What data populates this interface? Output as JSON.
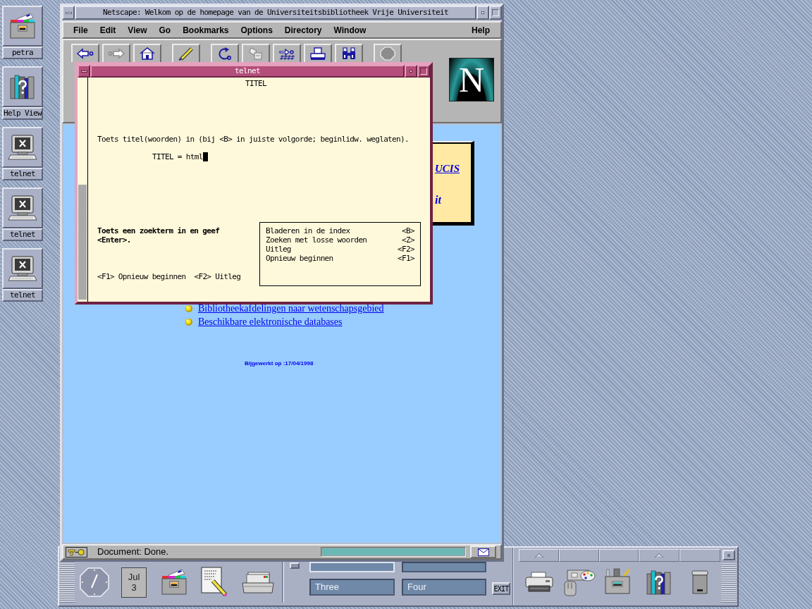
{
  "desktop_icons": [
    {
      "label": "petra",
      "kind": "folder"
    },
    {
      "label": "Help View",
      "kind": "help"
    },
    {
      "label": "telnet",
      "kind": "terminal"
    },
    {
      "label": "telnet",
      "kind": "terminal"
    },
    {
      "label": "telnet",
      "kind": "terminal"
    }
  ],
  "browser": {
    "title": "Netscape: Welkom op de homepage van de Universiteitsbibliotheek Vrije Universiteit",
    "menu": [
      "File",
      "Edit",
      "View",
      "Go",
      "Bookmarks",
      "Options",
      "Directory",
      "Window"
    ],
    "help_menu": "Help",
    "toolbar": [
      {
        "disabled": false
      },
      {
        "disabled": true
      },
      {
        "disabled": false
      },
      {
        "disabled": false
      },
      {
        "disabled": false
      },
      {
        "disabled": true
      },
      {
        "disabled": false
      },
      {
        "disabled": false
      },
      {
        "disabled": false
      },
      {
        "disabled": true
      }
    ],
    "logo": "N",
    "banner": {
      "link": "UCIS",
      "text": "it"
    },
    "links": [
      "Bibliotheekafdelingen naar wetenschapsgebied",
      "Beschikbare elektronische databases"
    ],
    "updated": "Bijgewerkt op :17/04/1998",
    "status": "Document: Done.",
    "progress": {
      "level": 1
    }
  },
  "telnet": {
    "title": "telnet",
    "screen_title": "TITEL",
    "prompt": "Toets titel(woorden) in (bij <B> in juiste volgorde; beginlidw. weglaten).",
    "input_label": "TITEL =",
    "input_value": "html",
    "hint": "Toets een zoekterm in en geef <Enter>.",
    "footer": [
      "<F1> Opnieuw beginnen",
      "<F2> Uitleg"
    ],
    "options": [
      {
        "label": "Bladeren in de index",
        "key": "<B>"
      },
      {
        "label": "Zoeken met losse woorden",
        "key": "<Z>"
      },
      {
        "label": "Uitleg",
        "key": "<F2>"
      },
      {
        "label": "Opnieuw beginnen",
        "key": "<F1>"
      }
    ]
  },
  "front_panel": {
    "calendar": {
      "month": "Jul",
      "day": "3"
    },
    "workspaces": [
      {
        "selected": true
      },
      {
        "selected": false
      },
      {
        "label": "Three",
        "selected": false
      },
      {
        "label": "Four",
        "selected": false
      }
    ],
    "exit": "EXIT",
    "apps": [
      {
        "subpanel": true
      },
      {
        "subpanel": false
      },
      {
        "subpanel": false
      },
      {
        "subpanel": true
      },
      {
        "subpanel": false
      }
    ]
  }
}
